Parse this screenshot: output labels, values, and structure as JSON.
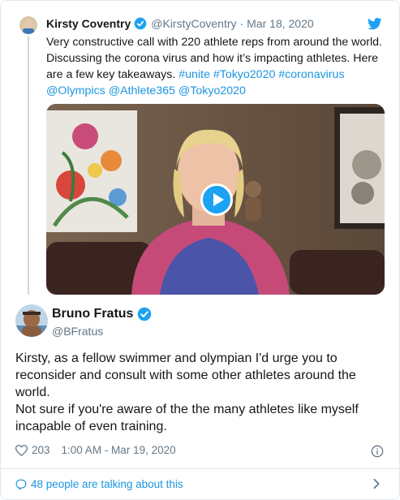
{
  "quoted_tweet": {
    "name": "Kirsty Coventry",
    "handle": "@KirstyCoventry",
    "separator": "·",
    "date": "Mar 18, 2020",
    "text_plain": "Very constructive call with 220 athlete reps from around the world. Discussing the corona virus and how it’s impacting athletes. Here are a few key takeaways. ",
    "hashtags": [
      "#unite",
      "#Tokyo2020",
      "#coronavirus"
    ],
    "mentions": [
      "@Olympics",
      "@Athlete365",
      "@Tokyo2020"
    ],
    "media": "video",
    "play_icon": "play-icon"
  },
  "main_tweet": {
    "name": "Bruno Fratus",
    "handle": "@BFratus",
    "lines": [
      "Kirsty, as a fellow swimmer and olympian I'd urge you to reconsider and consult with some other athletes around the world.",
      "Not sure if you're aware of the the many athletes like myself incapable of even training."
    ],
    "likes": "203",
    "timestamp": "1:00 AM - Mar 19, 2020"
  },
  "footer": {
    "talking": "48 people are talking about this"
  },
  "colors": {
    "link": "#1b95e0",
    "brand": "#1da1f2",
    "muted": "#657786",
    "divider": "#e1e8ed"
  },
  "icons": [
    "twitter-bird-icon",
    "verified-badge-icon",
    "heart-icon",
    "info-icon",
    "comment-bubble-icon",
    "chevron-right-icon"
  ]
}
